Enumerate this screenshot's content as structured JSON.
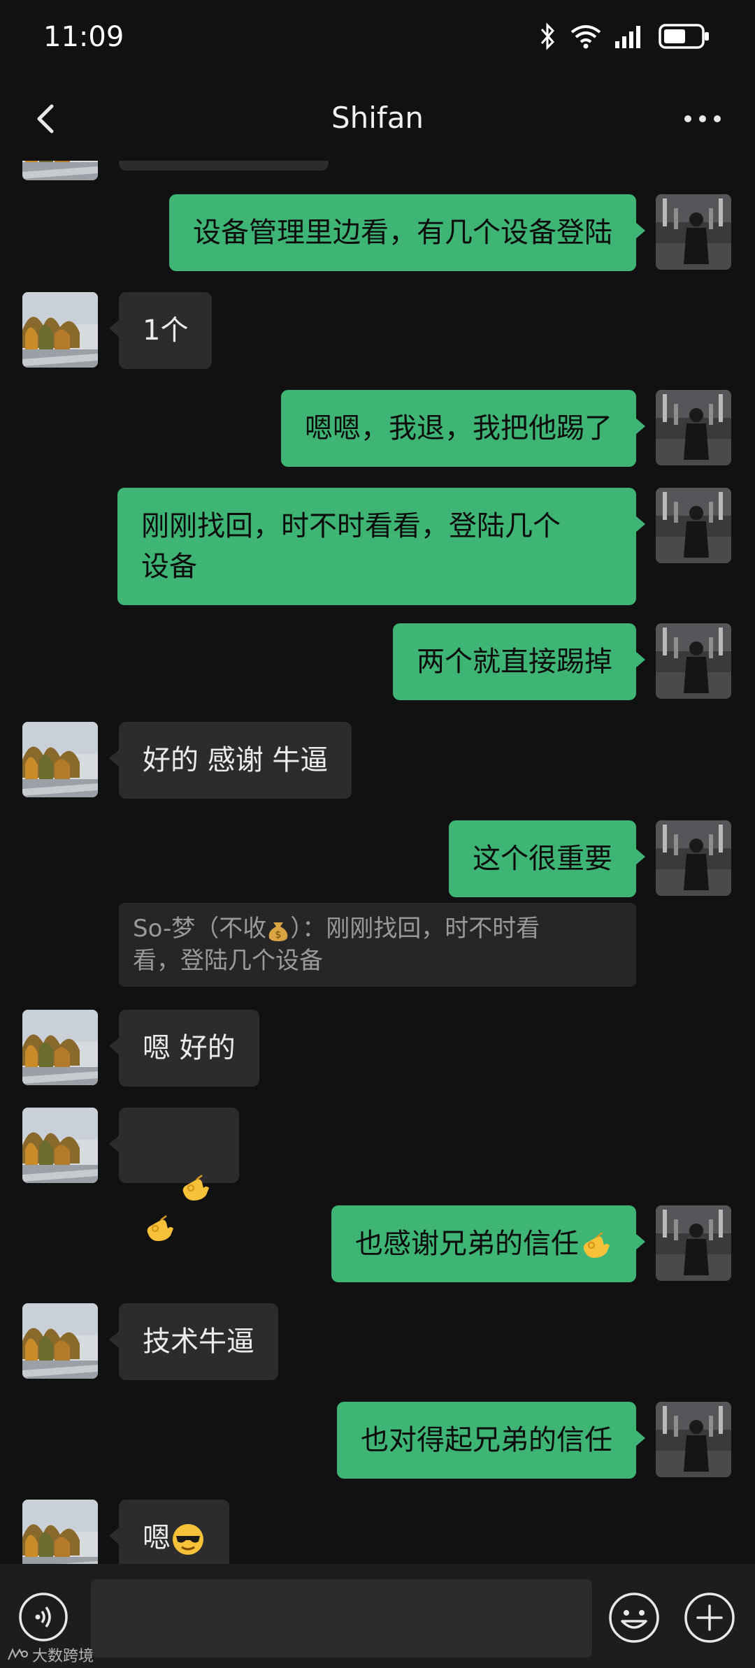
{
  "status": {
    "time": "11:09"
  },
  "nav": {
    "title": "Shifan"
  },
  "colors": {
    "sent_bubble": "#3eb575",
    "recv_bubble": "#2c2c2c",
    "background": "#111111"
  },
  "messages": [
    {
      "from": "me",
      "text": "设备管理里边看，有几个设备登陆"
    },
    {
      "from": "friend",
      "text": "1个"
    },
    {
      "from": "me",
      "text": "嗯嗯，我退，我把他踢了"
    },
    {
      "from": "me",
      "text": "刚刚找回，时不时看看，登陆几个\n设备"
    },
    {
      "from": "me",
      "text": "两个就直接踢掉"
    },
    {
      "from": "friend",
      "text": "好的 感谢 牛逼"
    },
    {
      "from": "me",
      "text": "这个很重要"
    },
    {
      "from": "friend",
      "text": "嗯 好的"
    },
    {
      "from": "friend",
      "text": "",
      "emoji": "ok-hand-ok-hand"
    },
    {
      "from": "me",
      "text": "也感谢兄弟的信任",
      "emoji": "ok-hand"
    },
    {
      "from": "friend",
      "text": "技术牛逼"
    },
    {
      "from": "me",
      "text": "也对得起兄弟的信任"
    },
    {
      "from": "friend",
      "text": "嗯",
      "emoji": "sunglasses-face"
    }
  ],
  "quote": {
    "sender": "So-梦（不收",
    "sender_suffix": "）：",
    "text": "刚刚找回，时不时看\n看，登陆几个设备",
    "emoji": "money-bag"
  },
  "input": {
    "placeholder": ""
  },
  "watermark": {
    "text": "大数跨境"
  }
}
